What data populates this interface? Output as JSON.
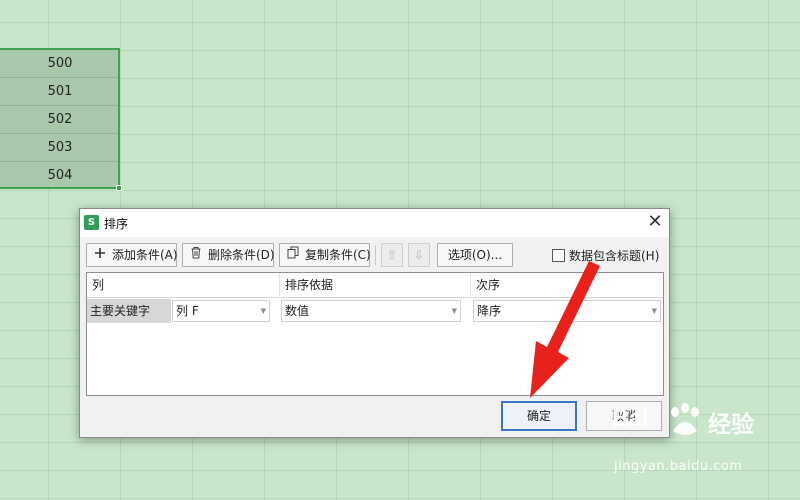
{
  "sheet": {
    "cells": [
      "500",
      "501",
      "502",
      "503",
      "504"
    ]
  },
  "dialog": {
    "title": "排序",
    "app_icon": "S",
    "close_label": "✕",
    "toolbar": {
      "add_label": "添加条件(A)",
      "delete_label": "删除条件(D)",
      "copy_label": "复制条件(C)",
      "up_label": "⇧",
      "down_label": "⇩",
      "options_label": "选项(O)...",
      "header_checkbox_label": "数据包含标题(H)",
      "header_checkbox_checked": false
    },
    "columns": {
      "col": "列",
      "basis": "排序依据",
      "order": "次序"
    },
    "rule": {
      "key_label": "主要关键字",
      "column_value": "列 F",
      "basis_value": "数值",
      "order_value": "降序"
    },
    "ok_label": "确定",
    "cancel_label": "取消"
  },
  "watermark": {
    "logo": "Bai",
    "brand": "经验",
    "url": "jingyan.baidu.com"
  },
  "colors": {
    "sheet_bg": "#c9e6cb",
    "selection_border": "#3fa34d",
    "selected_fill": "#a9c7aa",
    "ok_border": "#3a78c4",
    "arrow": "#e8211a"
  },
  "icons": [
    "plus-icon",
    "trash-icon",
    "copy-icon",
    "arrow-up-icon",
    "arrow-down-icon",
    "close-icon",
    "app-icon",
    "annotation-arrow-icon"
  ]
}
